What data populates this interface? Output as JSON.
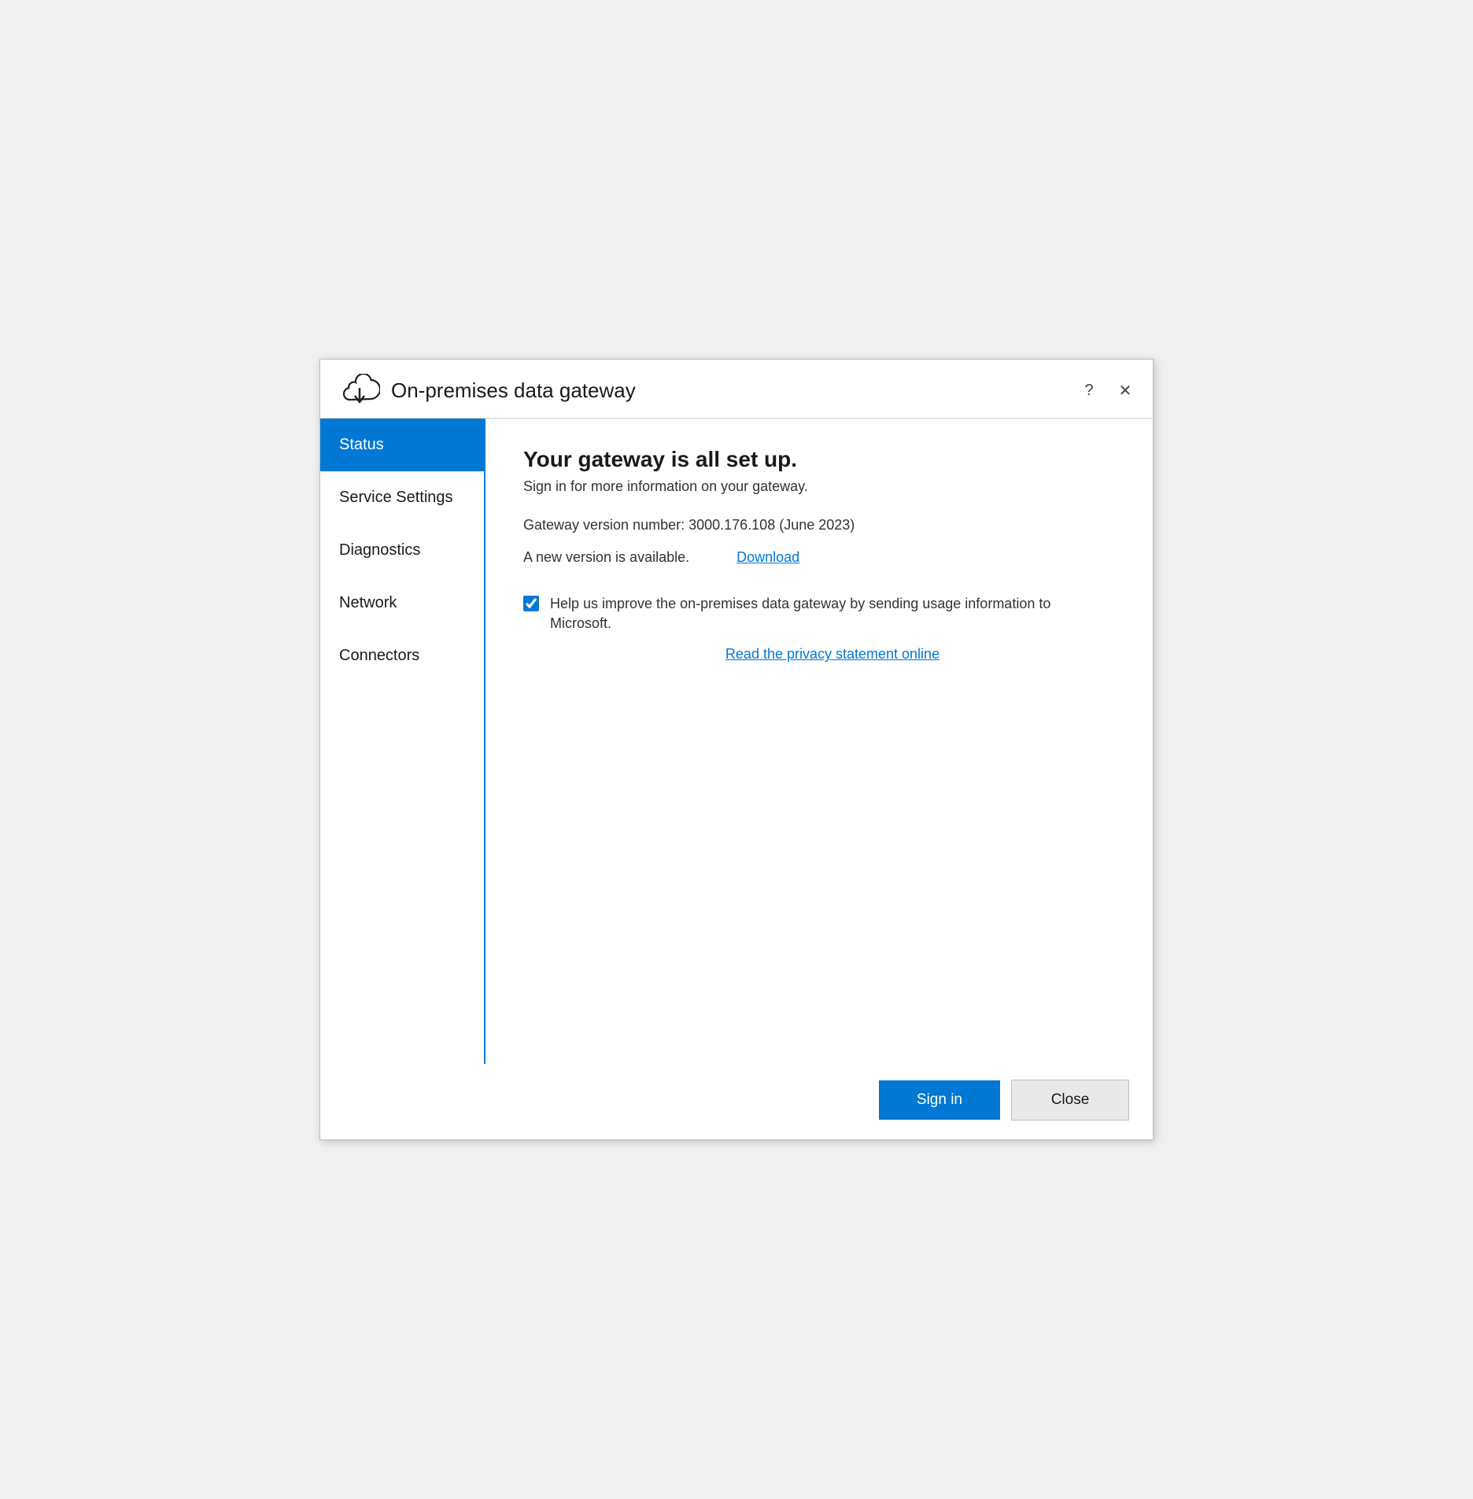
{
  "titlebar": {
    "app_title": "On-premises data gateway",
    "help_label": "?",
    "close_label": "✕"
  },
  "sidebar": {
    "items": [
      {
        "id": "status",
        "label": "Status",
        "active": true
      },
      {
        "id": "service-settings",
        "label": "Service Settings",
        "active": false
      },
      {
        "id": "diagnostics",
        "label": "Diagnostics",
        "active": false
      },
      {
        "id": "network",
        "label": "Network",
        "active": false
      },
      {
        "id": "connectors",
        "label": "Connectors",
        "active": false
      }
    ]
  },
  "content": {
    "heading": "Your gateway is all set up.",
    "subtext": "Sign in for more information on your gateway.",
    "version_text": "Gateway version number: 3000.176.108 (June 2023)",
    "new_version_label": "A new version is available.",
    "download_link_label": "Download",
    "checkbox_label": "Help us improve the on-premises data gateway by sending usage information to Microsoft.",
    "privacy_link_label": "Read the privacy statement online",
    "checkbox_checked": true
  },
  "footer": {
    "signin_label": "Sign in",
    "close_label": "Close"
  }
}
